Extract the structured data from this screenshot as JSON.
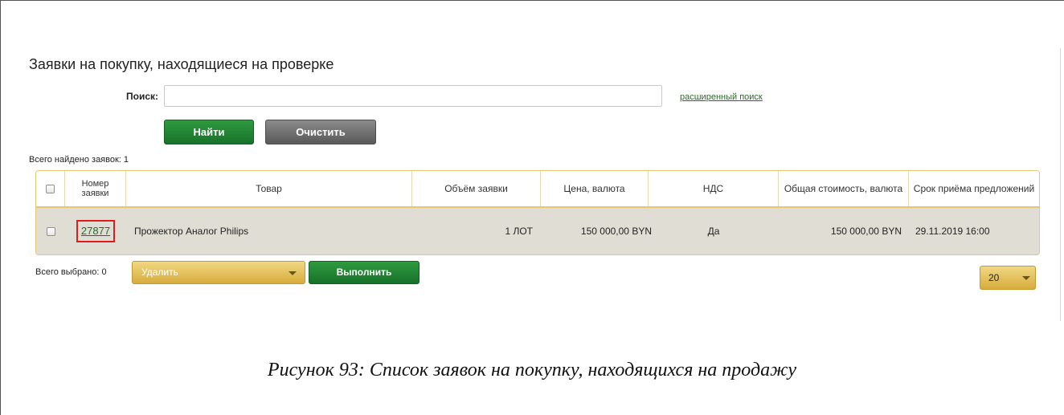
{
  "page": {
    "title": "Заявки на покупку, находящиеся на проверке"
  },
  "search": {
    "label": "Поиск:",
    "value": "",
    "placeholder": "",
    "advanced_link": "расширенный поиск",
    "find_button": "Найти",
    "clear_button": "Очистить"
  },
  "results": {
    "total_found": "Всего найдено заявок: 1"
  },
  "table": {
    "columns": {
      "number": "Номер заявки",
      "product": "Товар",
      "volume": "Объём заявки",
      "price": "Цена, валюта",
      "vat": "НДС",
      "total": "Общая стоимость, валюта",
      "deadline": "Срок приёма предложений"
    },
    "rows": [
      {
        "number": "27877",
        "product": "Прожектор Аналог Philips",
        "volume": "1 ЛОТ",
        "price": "150 000,00 BYN",
        "vat": "Да",
        "total": "150 000,00 BYN",
        "deadline": "29.11.2019 16:00"
      }
    ]
  },
  "footer": {
    "selected": "Всего выбрано: 0",
    "action_value": "Удалить",
    "execute_button": "Выполнить",
    "page_size": "20"
  },
  "caption": "Рисунок 93: Список заявок на покупку, находящихся на продажу",
  "colors": {
    "accent_green": "#17722a",
    "gold": "#d7ac3c",
    "row_bg": "#e0ded4",
    "highlight_red": "#e01b1b"
  }
}
